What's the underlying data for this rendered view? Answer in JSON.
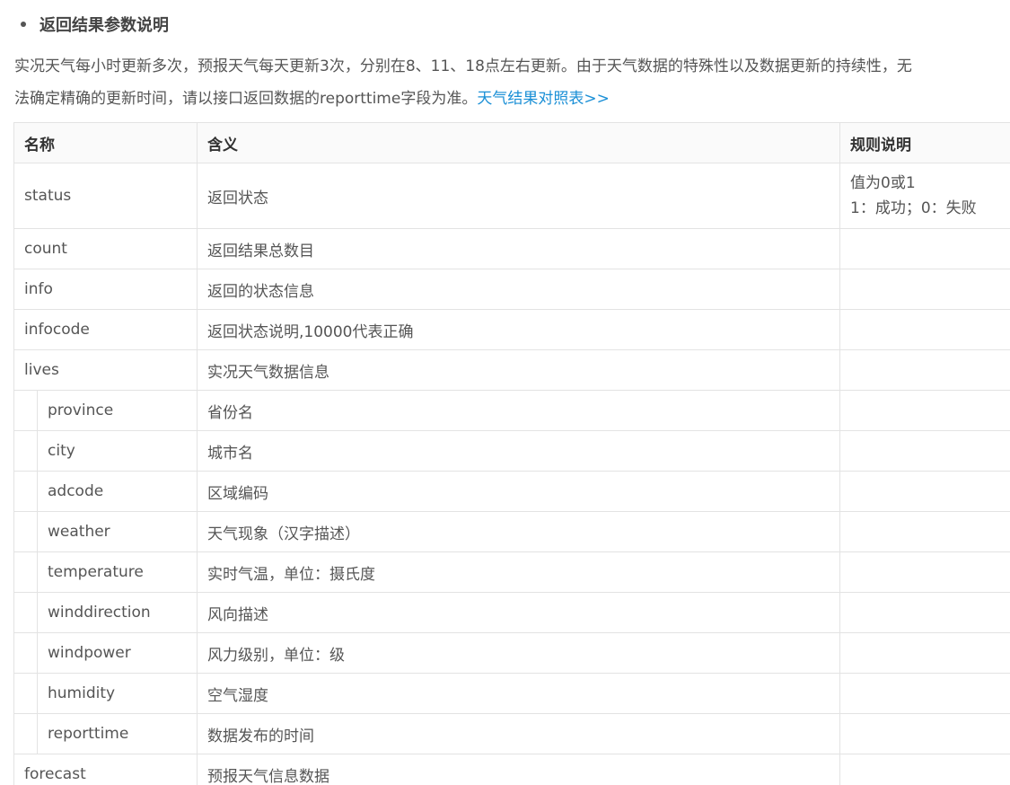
{
  "section": {
    "heading": "返回结果参数说明"
  },
  "intro": {
    "line1": "实况天气每小时更新多次，预报天气每天更新3次，分别在8、11、18点左右更新。由于天气数据的特殊性以及数据更新的持续性，无",
    "line2": "法确定精确的更新时间，请以接口返回数据的reporttime字段为准。",
    "link_text": "天气结果对照表>>"
  },
  "table": {
    "headers": [
      "名称",
      "含义",
      "规则说明"
    ],
    "rows": [
      {
        "name": "status",
        "meaning": "返回状态",
        "rule": "值为0或1\n1：成功；0：失败",
        "child": false
      },
      {
        "name": "count",
        "meaning": "返回结果总数目",
        "rule": "",
        "child": false
      },
      {
        "name": "info",
        "meaning": "返回的状态信息",
        "rule": "",
        "child": false
      },
      {
        "name": "infocode",
        "meaning": "返回状态说明,10000代表正确",
        "rule": "",
        "child": false
      },
      {
        "name": "lives",
        "meaning": "实况天气数据信息",
        "rule": "",
        "child": false
      },
      {
        "name": "province",
        "meaning": "省份名",
        "rule": "",
        "child": true
      },
      {
        "name": "city",
        "meaning": "城市名",
        "rule": "",
        "child": true
      },
      {
        "name": "adcode",
        "meaning": "区域编码",
        "rule": "",
        "child": true
      },
      {
        "name": "weather",
        "meaning": "天气现象（汉字描述）",
        "rule": "",
        "child": true
      },
      {
        "name": "temperature",
        "meaning": "实时气温，单位：摄氏度",
        "rule": "",
        "child": true
      },
      {
        "name": "winddirection",
        "meaning": "风向描述",
        "rule": "",
        "child": true
      },
      {
        "name": "windpower",
        "meaning": "风力级别，单位：级",
        "rule": "",
        "child": true
      },
      {
        "name": "humidity",
        "meaning": "空气湿度",
        "rule": "",
        "child": true
      },
      {
        "name": "reporttime",
        "meaning": "数据发布的时间",
        "rule": "",
        "child": true
      },
      {
        "name": "forecast",
        "meaning": "预报天气信息数据",
        "rule": "",
        "child": false
      }
    ]
  },
  "colors": {
    "link": "#1a8fd6",
    "text": "#555555",
    "border": "#e3e3e3",
    "header_bg": "#fafafa"
  }
}
